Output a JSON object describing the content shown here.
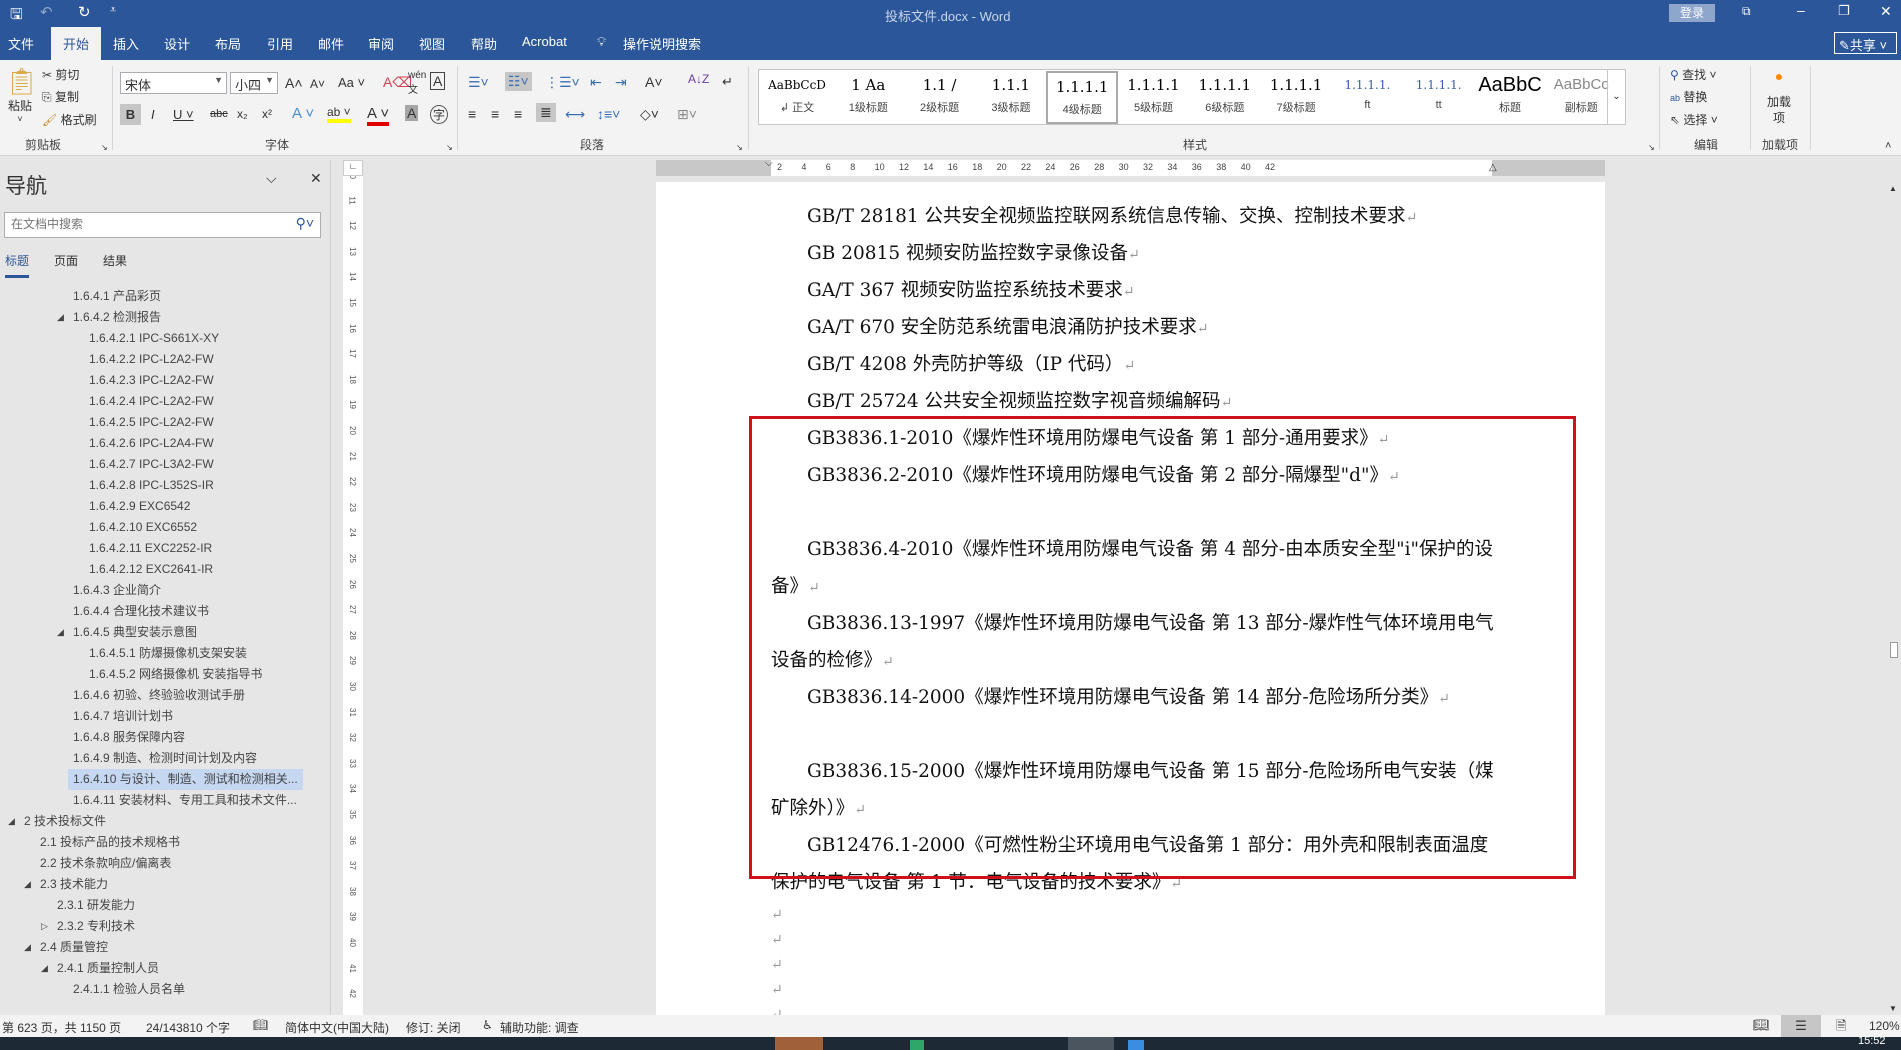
{
  "window": {
    "title": "投标文件.docx  -  Word",
    "login": "登录",
    "share": "共享"
  },
  "tabs": [
    "文件",
    "开始",
    "插入",
    "设计",
    "布局",
    "引用",
    "邮件",
    "审阅",
    "视图",
    "帮助",
    "Acrobat"
  ],
  "tell_me": "操作说明搜索",
  "clipboard": {
    "paste": "粘贴",
    "cut": "剪切",
    "copy": "复制",
    "format_painter": "格式刷",
    "label": "剪贴板"
  },
  "font": {
    "name": "宋体",
    "size": "小四",
    "label": "字体"
  },
  "paragraph": {
    "label": "段落"
  },
  "styles": {
    "label": "样式",
    "items": [
      {
        "preview": "AaBbCcD",
        "label": "↲ 正文"
      },
      {
        "preview": "1  Aa",
        "label": "1级标题"
      },
      {
        "preview": "1.1  /",
        "label": "2级标题"
      },
      {
        "preview": "1.1.1",
        "label": "3级标题"
      },
      {
        "preview": "1.1.1.1",
        "label": "4级标题",
        "selected": true
      },
      {
        "preview": "1.1.1.1",
        "label": "5级标题"
      },
      {
        "preview": "1.1.1.1",
        "label": "6级标题"
      },
      {
        "preview": "1.1.1.1",
        "label": "7级标题"
      },
      {
        "preview": "1.1.1.1.",
        "label": "ft"
      },
      {
        "preview": "1.1.1.1.",
        "label": "tt"
      },
      {
        "preview": "AaBbC",
        "label": "标题"
      },
      {
        "preview": "AaBbCc",
        "label": "副标题"
      }
    ]
  },
  "editing": {
    "find": "查找",
    "replace": "替换",
    "select": "选择",
    "label": "编辑"
  },
  "addins": {
    "button": "加载项",
    "label": "加载项"
  },
  "nav": {
    "title": "导航",
    "search_placeholder": "在文档中搜索",
    "tabs": [
      "标题",
      "页面",
      "结果"
    ],
    "items": [
      {
        "text": "1.6.4.1 产品彩页",
        "level": 3
      },
      {
        "text": "1.6.4.2 检测报告",
        "level": 3,
        "expanded": true
      },
      {
        "text": "1.6.4.2.1 IPC-S661X-XY",
        "level": 4
      },
      {
        "text": "1.6.4.2.2 IPC-L2A2-FW",
        "level": 4
      },
      {
        "text": "1.6.4.2.3 IPC-L2A2-FW",
        "level": 4
      },
      {
        "text": "1.6.4.2.4 IPC-L2A2-FW",
        "level": 4
      },
      {
        "text": "1.6.4.2.5 IPC-L2A2-FW",
        "level": 4
      },
      {
        "text": "1.6.4.2.6 IPC-L2A4-FW",
        "level": 4
      },
      {
        "text": "1.6.4.2.7 IPC-L3A2-FW",
        "level": 4
      },
      {
        "text": "1.6.4.2.8 IPC-L352S-IR",
        "level": 4
      },
      {
        "text": "1.6.4.2.9 EXC6542",
        "level": 4
      },
      {
        "text": "1.6.4.2.10 EXC6552",
        "level": 4
      },
      {
        "text": "1.6.4.2.11 EXC2252-IR",
        "level": 4
      },
      {
        "text": "1.6.4.2.12 EXC2641-IR",
        "level": 4
      },
      {
        "text": "1.6.4.3 企业简介",
        "level": 3
      },
      {
        "text": "1.6.4.4 合理化技术建议书",
        "level": 3
      },
      {
        "text": "1.6.4.5 典型安装示意图",
        "level": 3,
        "expanded": true
      },
      {
        "text": "1.6.4.5.1 防爆摄像机支架安装",
        "level": 4
      },
      {
        "text": "1.6.4.5.2 网络摄像机 安装指导书",
        "level": 4
      },
      {
        "text": "1.6.4.6 初验、终验验收测试手册",
        "level": 3
      },
      {
        "text": "1.6.4.7 培训计划书",
        "level": 3
      },
      {
        "text": "1.6.4.8 服务保障内容",
        "level": 3
      },
      {
        "text": "1.6.4.9 制造、检测时间计划及内容",
        "level": 3
      },
      {
        "text": "1.6.4.10 与设计、制造、测试和检测相关...",
        "level": 3,
        "selected": true
      },
      {
        "text": "1.6.4.11 安装材料、专用工具和技术文件...",
        "level": 3
      },
      {
        "text": "2 技术投标文件",
        "level": 0,
        "expanded": true
      },
      {
        "text": "2.1 投标产品的技术规格书",
        "level": 1
      },
      {
        "text": "2.2 技术条款响应/偏离表",
        "level": 1
      },
      {
        "text": "2.3 技术能力",
        "level": 1,
        "expanded": true
      },
      {
        "text": "2.3.1 研发能力",
        "level": 2
      },
      {
        "text": "2.3.2 专利技术",
        "level": 2,
        "collapsed": true
      },
      {
        "text": "2.4 质量管控",
        "level": 1,
        "expanded": true
      },
      {
        "text": "2.4.1 质量控制人员",
        "level": 2,
        "expanded": true
      },
      {
        "text": "2.4.1.1 检验人员名单",
        "level": 3
      }
    ]
  },
  "ruler": {
    "labels": [
      "2",
      "4",
      "6",
      "8",
      "10",
      "12",
      "14",
      "16",
      "18",
      "20",
      "22",
      "24",
      "26",
      "28",
      "30",
      "32",
      "34",
      "36",
      "38",
      "40",
      "42"
    ]
  },
  "document": {
    "paragraphs": [
      "GB/T 28181 公共安全视频监控联网系统信息传输、交换、控制技术要求",
      "GB 20815 视频安防监控数字录像设备",
      "GA/T 367 视频安防监控系统技术要求",
      "GA/T 670 安全防范系统雷电浪涌防护技术要求",
      "GB/T 4208 外壳防护等级（IP 代码）",
      "GB/T 25724 公共安全视频监控数字视音频编解码",
      "GB3836.1-2010《爆炸性环境用防爆电气设备 第 1 部分-通用要求》",
      "GB3836.2-2010《爆炸性环境用防爆电气设备 第 2 部分-隔爆型\"d\"》",
      "GB3836.4-2010《爆炸性环境用防爆电气设备 第 4 部分-由本质安全型\"i\"保护的设备》",
      "GB3836.13-1997《爆炸性环境用防爆电气设备 第 13 部分-爆炸性气体环境用电气设备的检修》",
      "GB3836.14-2000《爆炸性环境用防爆电气设备 第 14 部分-危险场所分类》",
      "GB3836.15-2000《爆炸性环境用防爆电气设备 第 15 部分-危险场所电气安装（煤矿除外）》",
      "GB12476.1-2000《可燃性粉尘环境用电气设备第 1 部分：用外壳和限制表面温度保护的电气设备 第 1 节：电气设备的技术要求》",
      "",
      "",
      "",
      "",
      "",
      "",
      ""
    ],
    "para_mark": "↵",
    "highlight_color": "#d0101d"
  },
  "status": {
    "page": "第 623 页，共 1150 页",
    "words": "24/143810 个字",
    "language": "简体中文(中国大陆)",
    "track": "修订: 关闭",
    "accessibility": "辅助功能: 调查",
    "zoom": "120%",
    "time": "15:52"
  },
  "colors": {
    "brand": "#2b579a"
  }
}
